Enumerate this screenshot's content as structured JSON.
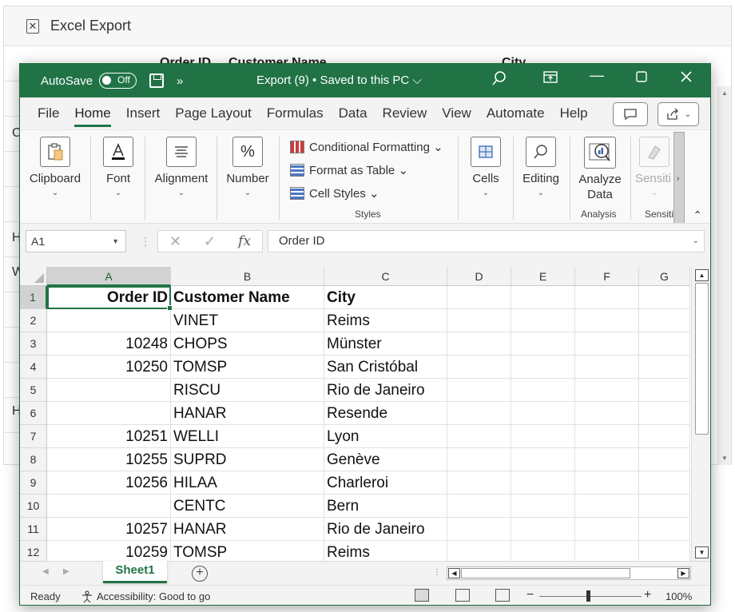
{
  "background_app": {
    "title": "Excel Export",
    "header_order_id": "Order ID",
    "header_customer_name": "Customer Name",
    "header_city": "City",
    "row_letters": [
      "C",
      "H",
      "W",
      "H"
    ]
  },
  "excel": {
    "autosave_label": "AutoSave",
    "autosave_state": "Off",
    "more_commands": "»",
    "doc_title": "Export (9) • Saved to this PC ⌵",
    "accent_color": "#217346",
    "tabs": [
      "File",
      "Home",
      "Insert",
      "Page Layout",
      "Formulas",
      "Data",
      "Review",
      "View",
      "Automate",
      "Help"
    ],
    "active_tab": "Home",
    "ribbon": {
      "clipboard": "Clipboard",
      "font": "Font",
      "alignment": "Alignment",
      "number": "Number",
      "conditional_formatting": "Conditional Formatting ⌄",
      "format_as_table": "Format as Table ⌄",
      "cell_styles": "Cell Styles ⌄",
      "styles_group": "Styles",
      "cells": "Cells",
      "editing": "Editing",
      "analyze_data": "Analyze\nData",
      "analysis_group": "Analysis",
      "sensitivity": "Sensiti",
      "sensitivity_group": "Sensiti"
    },
    "formula_bar": {
      "name_box": "A1",
      "formula": "Order ID"
    },
    "columns": [
      "A",
      "B",
      "C",
      "D",
      "E",
      "F",
      "G"
    ],
    "rows": [
      {
        "n": "1",
        "a": "Order ID",
        "b": "Customer Name",
        "c": "City"
      },
      {
        "n": "2",
        "a": "",
        "b": "VINET",
        "c": "Reims"
      },
      {
        "n": "3",
        "a": "10248",
        "b": "CHOPS",
        "c": "Münster"
      },
      {
        "n": "4",
        "a": "10250",
        "b": "TOMSP",
        "c": "San Cristóbal"
      },
      {
        "n": "5",
        "a": "",
        "b": "RISCU",
        "c": "Rio de Janeiro"
      },
      {
        "n": "6",
        "a": "",
        "b": "HANAR",
        "c": "Resende"
      },
      {
        "n": "7",
        "a": "10251",
        "b": "WELLI",
        "c": "Lyon"
      },
      {
        "n": "8",
        "a": "10255",
        "b": "SUPRD",
        "c": "Genève"
      },
      {
        "n": "9",
        "a": "10256",
        "b": "HILAA",
        "c": "Charleroi"
      },
      {
        "n": "10",
        "a": "",
        "b": "CENTC",
        "c": "Bern"
      },
      {
        "n": "11",
        "a": "10257",
        "b": "HANAR",
        "c": "Rio de Janeiro"
      },
      {
        "n": "12",
        "a": "10259",
        "b": "TOMSP",
        "c": "Reims"
      }
    ],
    "sheet_tab": "Sheet1",
    "status": {
      "ready": "Ready",
      "accessibility": "Accessibility: Good to go",
      "zoom": "100%"
    }
  }
}
